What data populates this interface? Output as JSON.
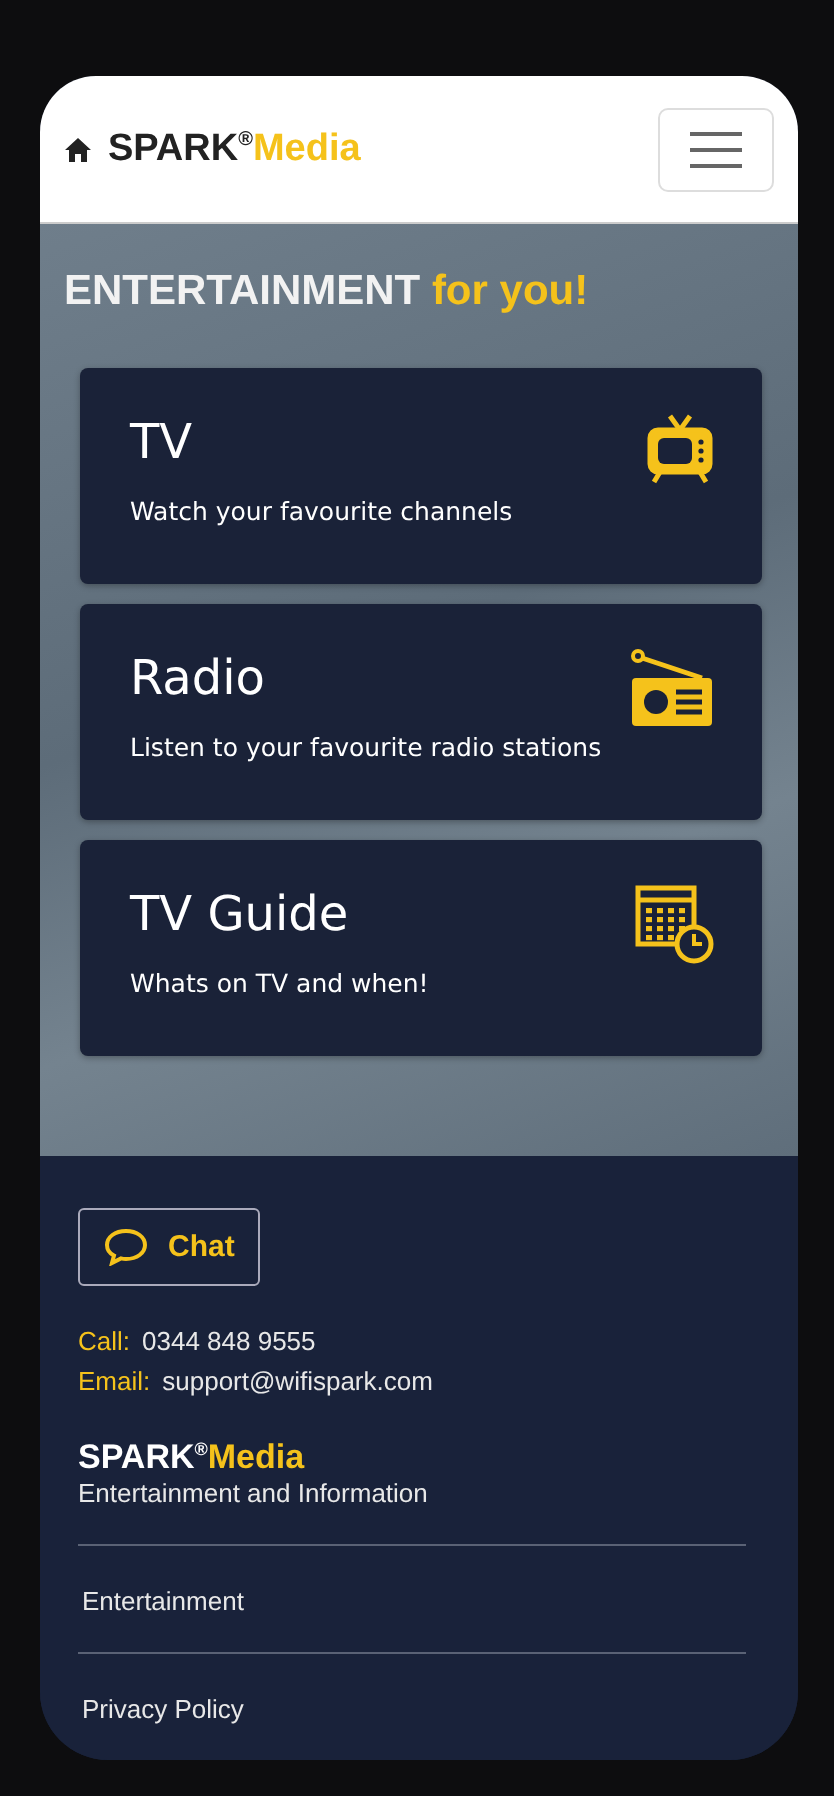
{
  "header": {
    "logo": {
      "brand": "SPARK",
      "mark": "®",
      "product": "Media"
    }
  },
  "hero": {
    "title": "ENTERTAINMENT",
    "highlight": "for you!"
  },
  "cards": [
    {
      "kind": "tv",
      "title": "TV",
      "subtitle": "Watch your favourite channels"
    },
    {
      "kind": "radio",
      "title": "Radio",
      "subtitle": "Listen to your favourite radio stations"
    },
    {
      "kind": "guide",
      "title": "TV Guide",
      "subtitle": "Whats on TV and when!"
    }
  ],
  "footer": {
    "chat_button": "Chat",
    "contacts": [
      {
        "label": "Call:",
        "value": "0344 848 9555"
      },
      {
        "label": "Email:",
        "value": "support@wifispark.com"
      }
    ],
    "logo": {
      "brand": "SPARK",
      "mark": "®",
      "product": "Media"
    },
    "tagline": "Entertainment and Information",
    "links": [
      "Entertainment",
      "Privacy Policy"
    ]
  }
}
